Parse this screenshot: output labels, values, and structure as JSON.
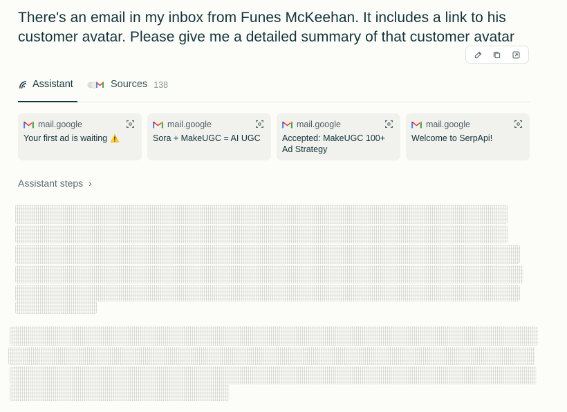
{
  "query": {
    "text": "There's an email in my inbox from Funes McKeehan. It includes a link to his customer avatar. Please give me a detailed summary of that customer avatar",
    "actions": [
      {
        "name": "edit-icon"
      },
      {
        "name": "copy-icon"
      },
      {
        "name": "share-icon"
      }
    ]
  },
  "tabs": {
    "assistant_label": "Assistant",
    "sources_label": "Sources",
    "sources_count": "138"
  },
  "sources": [
    {
      "domain": "mail.google",
      "title": "Your first ad is waiting",
      "badge": "⚠️"
    },
    {
      "domain": "mail.google",
      "title": "Sora + MakeUGC = AI UGC",
      "badge": ""
    },
    {
      "domain": "mail.google",
      "title": "Accepted: MakeUGC 100+ Ad Strategy",
      "badge": ""
    },
    {
      "domain": "mail.google",
      "title": "Welcome to SerpApi!",
      "badge": ""
    }
  ],
  "assistant_steps_label": "Assistant steps",
  "colors": {
    "text": "#13343b",
    "background": "#fcfcf9",
    "card": "#f1f1ee"
  }
}
